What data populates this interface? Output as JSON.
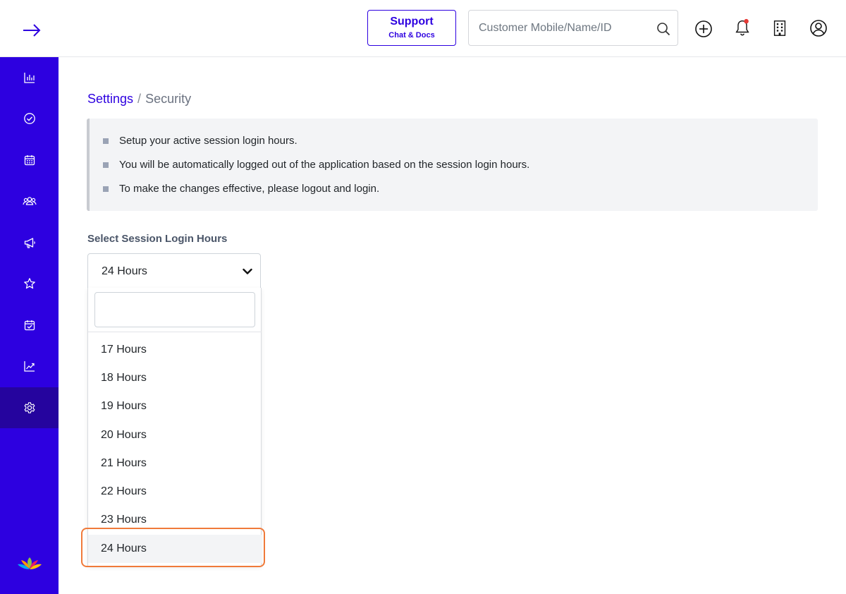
{
  "topbar": {
    "support_title": "Support",
    "support_subtitle": "Chat & Docs",
    "search_placeholder": "Customer Mobile/Name/ID"
  },
  "sidebar": {
    "items": [
      {
        "icon": "bar-chart-icon"
      },
      {
        "icon": "check-circle-icon"
      },
      {
        "icon": "calendar-icon"
      },
      {
        "icon": "users-icon"
      },
      {
        "icon": "megaphone-icon"
      },
      {
        "icon": "star-icon"
      },
      {
        "icon": "calendar-check-icon"
      },
      {
        "icon": "trend-chart-icon"
      },
      {
        "icon": "gear-icon",
        "active": true
      }
    ]
  },
  "breadcrumb": {
    "parent": "Settings",
    "separator": "/",
    "current": "Security"
  },
  "info": {
    "items": [
      "Setup your active session login hours.",
      "You will be automatically logged out of the application based on the session login hours.",
      "To make the changes effective, please logout and login."
    ]
  },
  "session": {
    "label": "Select Session Login Hours",
    "selected": "24 Hours",
    "search_value": "",
    "options": [
      "17 Hours",
      "18 Hours",
      "19 Hours",
      "20 Hours",
      "21 Hours",
      "22 Hours",
      "23 Hours",
      "24 Hours"
    ]
  },
  "colors": {
    "brand": "#2d00e0",
    "sidebar_active": "#25049e",
    "highlight": "#f07a3a",
    "notification_dot": "#e53935"
  }
}
